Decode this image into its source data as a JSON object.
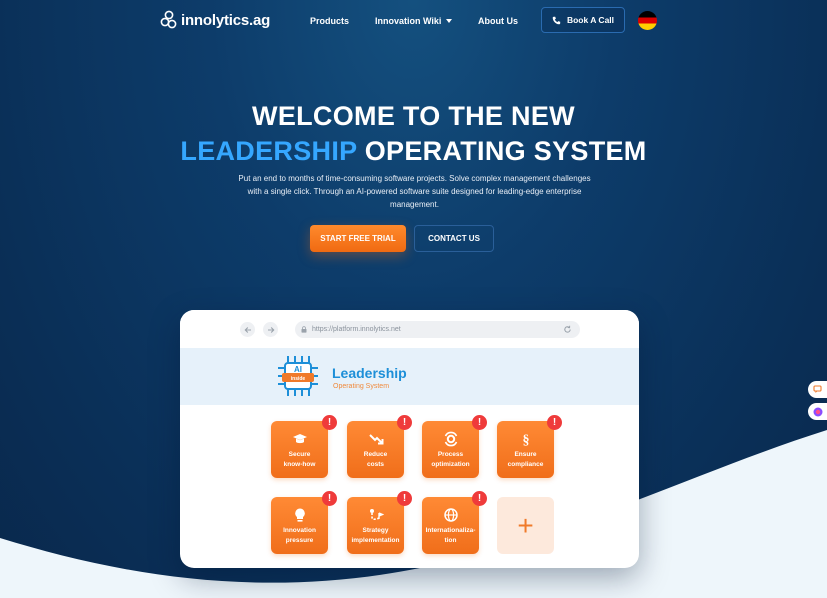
{
  "header": {
    "logo_text": "innolytics.ag",
    "nav": {
      "products": "Products",
      "wiki": "Innovation Wiki",
      "about": "About Us"
    },
    "book_call": "Book A Call",
    "language_flag": "de-flag-icon"
  },
  "hero": {
    "line1": "WELCOME TO THE NEW",
    "line2_accent": "LEADERSHIP",
    "line2_rest": " OPERATING SYSTEM",
    "lead": "Put an end to months of time-consuming software projects. Solve complex management challenges with a single click. Through an AI-powered software suite designed for leading-edge enterprise management.",
    "cta_trial": "START FREE TRIAL",
    "cta_contact": "CONTACT US"
  },
  "browser": {
    "url": "https://platform.innolytics.net",
    "app_title": "Leadership",
    "app_subtitle": "Operating System",
    "badge_text": "AI",
    "badge_sub": "inside",
    "alert_symbol": "!",
    "add_symbol": "+",
    "tiles": [
      {
        "label1": "Secure",
        "label2": "know-how",
        "icon": "graduation-cap-icon"
      },
      {
        "label1": "Reduce",
        "label2": "costs",
        "icon": "trend-down-icon"
      },
      {
        "label1": "Process",
        "label2": "optimization",
        "icon": "gear-process-icon"
      },
      {
        "label1": "Ensure",
        "label2": "compliance",
        "icon": "paragraph-icon"
      },
      {
        "label1": "Innovation",
        "label2": "pressure",
        "icon": "lightbulb-icon"
      },
      {
        "label1": "Strategy",
        "label2": "implementation",
        "icon": "strategy-path-icon"
      },
      {
        "label1": "Internationaliza-",
        "label2": "tion",
        "icon": "globe-icon"
      }
    ]
  },
  "colors": {
    "accent_blue": "#35a7ff",
    "cta_orange": "#f47a20",
    "background_navy": "#0b3562",
    "alert_red": "#ef3b3b"
  }
}
